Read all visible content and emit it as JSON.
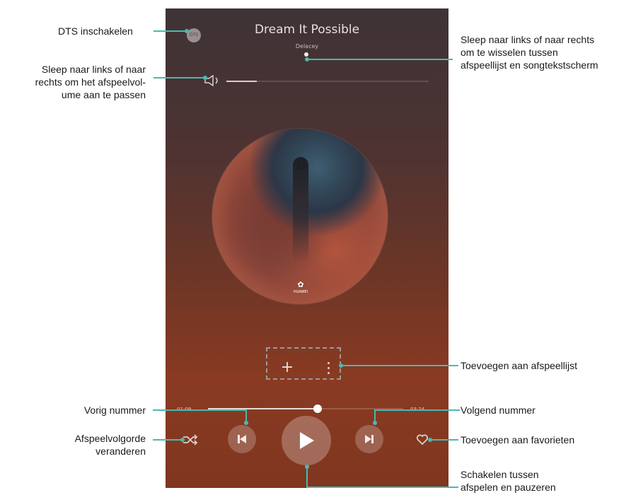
{
  "player": {
    "song_title": "Dream It Possible",
    "artist": "Delacey",
    "dts_label": "DTS",
    "current_time": "01:09",
    "total_time": "03:24",
    "progress": 0.56,
    "volume": 0.15,
    "brand_name": "HUAWEI",
    "page_indicator": "1 of 2"
  },
  "callouts": {
    "dts": "DTS inschakelen",
    "volume": [
      "Sleep naar links of naar",
      "rechts om het afspeelvol-",
      "ume aan te passen"
    ],
    "swipe": [
      "Sleep naar links of naar rechts",
      "om te wisselen tussen",
      "afspeellijst en songtekstscherm"
    ],
    "add_playlist": "Toevoegen aan afspeellijst",
    "previous": "Vorig nummer",
    "next": "Volgend nummer",
    "shuffle": [
      "Afspeelvolgorde",
      "veranderen"
    ],
    "favorite": "Toevoegen aan favorieten",
    "play": [
      "Schakelen tussen",
      "afspelen en pauzeren"
    ]
  },
  "colors": {
    "leader_line": "#4bb8b0",
    "background_top": "#3e3336",
    "background_bottom": "#8a3a22"
  },
  "icons": {
    "dts": "dts-icon",
    "volume": "speaker-icon",
    "add": "plus-icon",
    "more": "vertical-dots-icon",
    "previous": "skip-previous-icon",
    "play": "play-icon",
    "next": "skip-next-icon",
    "shuffle": "shuffle-icon",
    "favorite": "heart-icon"
  }
}
